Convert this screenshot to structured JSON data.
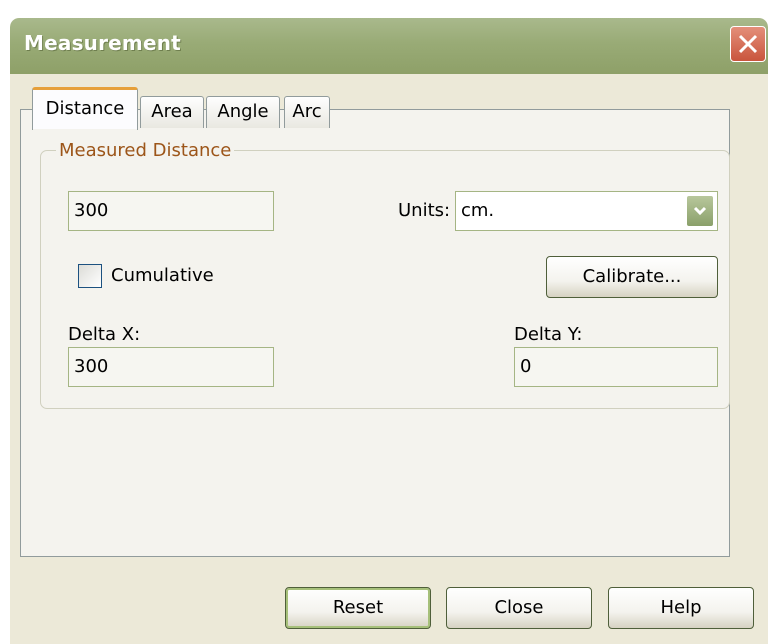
{
  "window": {
    "title": "Measurement"
  },
  "tabs": [
    {
      "label": "Distance",
      "active": true
    },
    {
      "label": "Area",
      "active": false
    },
    {
      "label": "Angle",
      "active": false
    },
    {
      "label": "Arc",
      "active": false
    }
  ],
  "group": {
    "title": "Measured Distance",
    "distance_value": "300",
    "units_label": "Units:",
    "units_value": "cm.",
    "cumulative_label": "Cumulative",
    "cumulative_checked": false,
    "calibrate_label": "Calibrate...",
    "delta_x_label": "Delta X:",
    "delta_x_value": "300",
    "delta_y_label": "Delta Y:",
    "delta_y_value": "0"
  },
  "buttons": {
    "reset": "Reset",
    "close": "Close",
    "help": "Help"
  },
  "icons": {
    "close": "close-icon",
    "dropdown": "chevron-down-icon"
  },
  "colors": {
    "titlebar": "#99ab76",
    "group_title": "#9c5519",
    "active_tab_accent": "#e6a03a"
  }
}
